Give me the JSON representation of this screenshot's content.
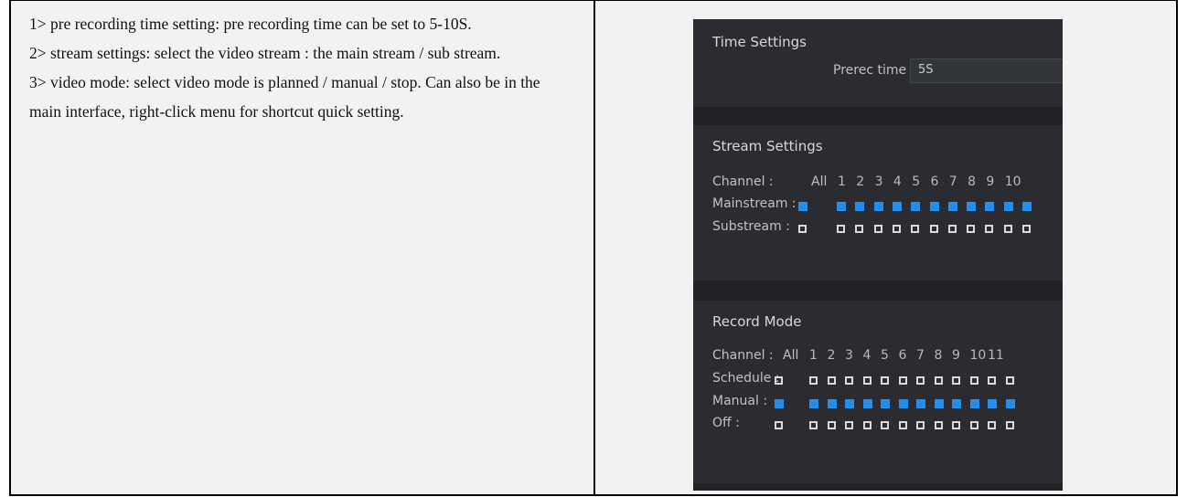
{
  "doc": {
    "paragraphs": [
      "1> pre recording time setting: pre recording time can be set to 5-10S.",
      "2> stream settings: select the video stream : the main stream / sub stream.",
      "3> video mode: select video mode is planned / manual / stop. Can also be in the main interface, right-click menu for shortcut quick setting."
    ]
  },
  "ui": {
    "time_settings": {
      "title": "Time Settings",
      "prerec_label": "Prerec time :",
      "prerec_value": "5S"
    },
    "stream_settings": {
      "title": "Stream Settings",
      "channel_label": "Channel :",
      "all_label": "All",
      "channel_numbers": [
        "1",
        "2",
        "3",
        "4",
        "5",
        "6",
        "7",
        "8",
        "9",
        "10"
      ],
      "mainstream_label": "Mainstream :",
      "substream_label": "Substream :",
      "mainstream_all": true,
      "substream_all": false,
      "mainstream_checked": [
        true,
        true,
        true,
        true,
        true,
        true,
        true,
        true,
        true,
        true,
        true
      ],
      "substream_checked": [
        false,
        false,
        false,
        false,
        false,
        false,
        false,
        false,
        false,
        false,
        false
      ]
    },
    "record_mode": {
      "title": "Record Mode",
      "channel_label": "Channel :",
      "all_label": "All",
      "channel_numbers": [
        "1",
        "2",
        "3",
        "4",
        "5",
        "6",
        "7",
        "8",
        "9",
        "10",
        "11"
      ],
      "schedule_label": "Schedule :",
      "manual_label": "Manual :",
      "off_label": "Off :",
      "schedule_all": false,
      "manual_all": true,
      "off_all": false,
      "schedule_checked": [
        false,
        false,
        false,
        false,
        false,
        false,
        false,
        false,
        false,
        false,
        false,
        false
      ],
      "manual_checked": [
        true,
        true,
        true,
        true,
        true,
        true,
        true,
        true,
        true,
        true,
        true,
        true
      ],
      "off_checked": [
        false,
        false,
        false,
        false,
        false,
        false,
        false,
        false,
        false,
        false,
        false,
        false
      ]
    },
    "colors": {
      "panel_bg": "#2b2c31",
      "divider_bg": "#222327",
      "checked_blue": "#1e8ef0",
      "unchecked_border": "#d9dade"
    }
  }
}
